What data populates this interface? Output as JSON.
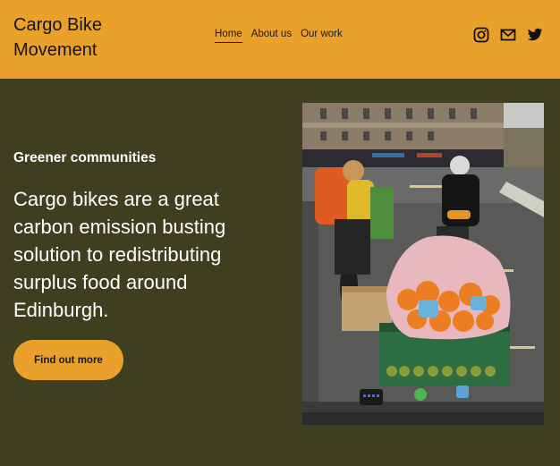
{
  "brand": {
    "name": "Cargo Bike Movement"
  },
  "nav": {
    "items": [
      "Home",
      "About us",
      "Our work"
    ],
    "active_index": 0
  },
  "social": {
    "icons": [
      "instagram-icon",
      "mail-icon",
      "twitter-icon"
    ]
  },
  "hero": {
    "subtitle": "Greener communities",
    "headline": "Cargo bikes are a great carbon emission busting solution to redistributing surplus food around Edinburgh.",
    "cta_label": "Find out more"
  },
  "colors": {
    "header_bg": "#e9a12c",
    "page_bg": "#3d3f1f",
    "text_light": "#ffffff",
    "text_dark": "#141414"
  }
}
